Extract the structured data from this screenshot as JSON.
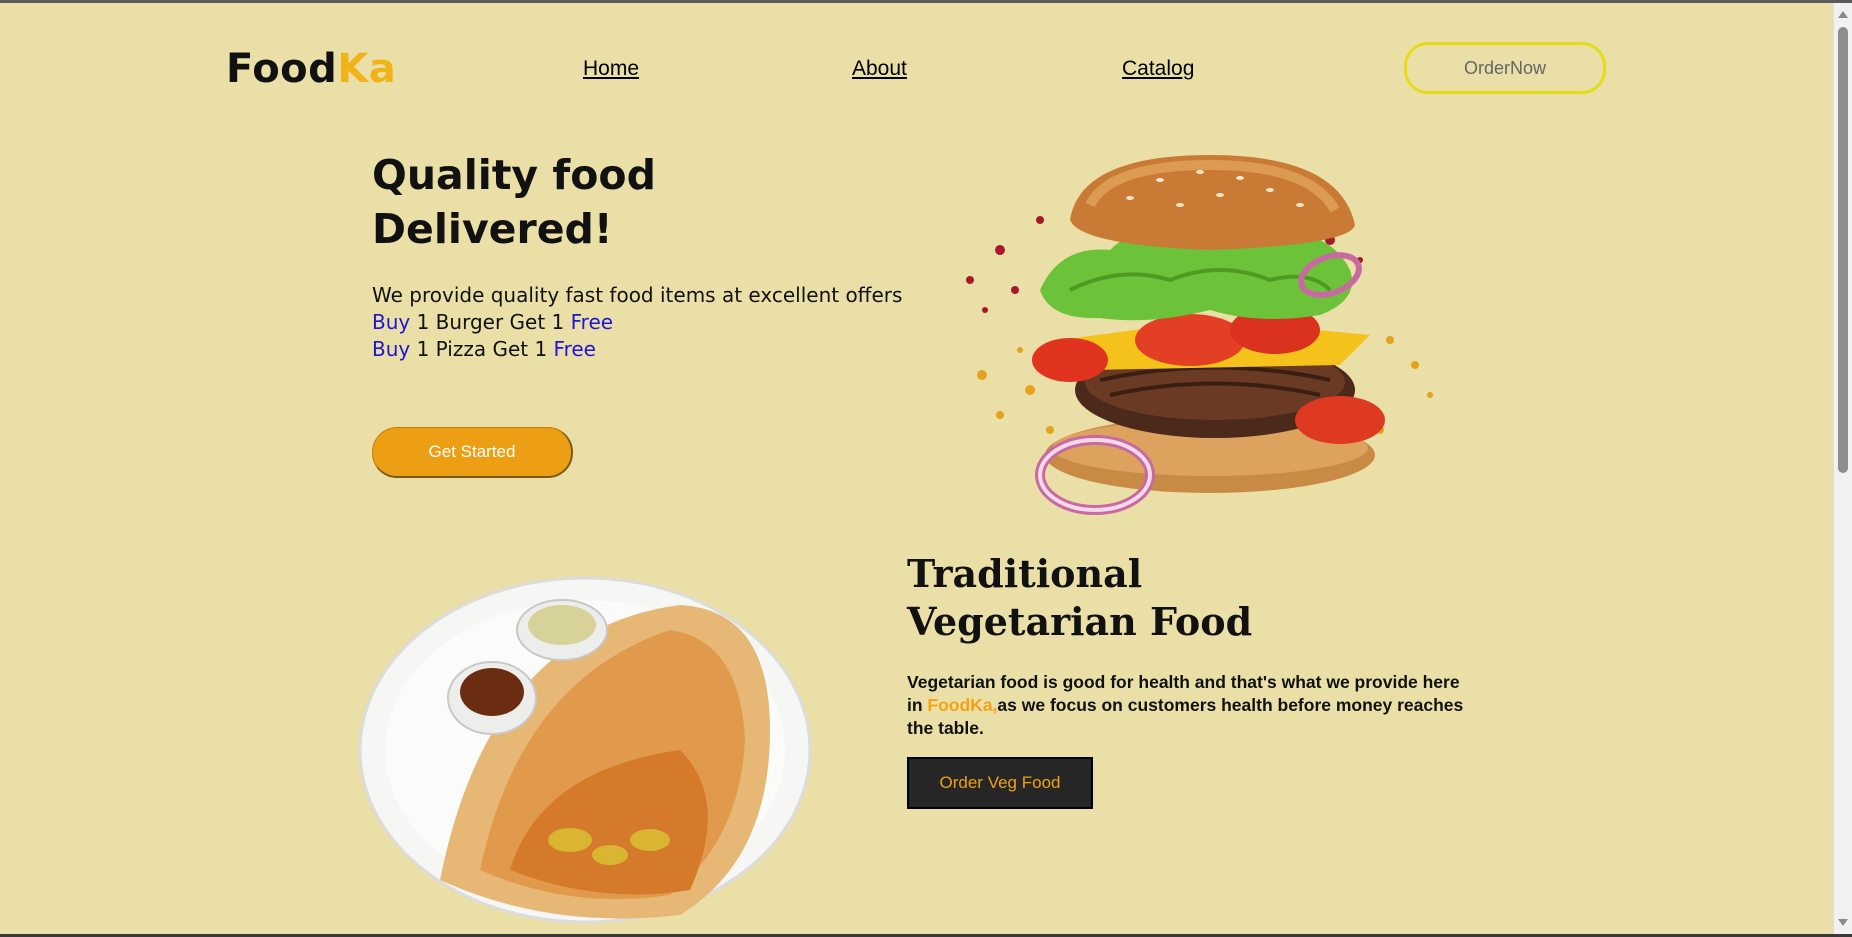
{
  "brand": {
    "name_main": "Food",
    "name_accent": "Ka"
  },
  "nav": {
    "home": "Home",
    "about": "About",
    "catalog": "Catalog",
    "order_now": "OrderNow"
  },
  "hero": {
    "title_line1": "Quality food",
    "title_line2": "Delivered!",
    "desc": "We provide quality fast food items at excellent offers",
    "offer1": {
      "buy": "Buy",
      "middle": " 1 Burger Get 1 ",
      "free": "Free"
    },
    "offer2": {
      "buy": "Buy",
      "middle": " 1 Pizza Get 1 ",
      "free": "Free"
    },
    "cta": "Get Started"
  },
  "veg": {
    "title_line1": "Traditional",
    "title_line2": "Vegetarian Food",
    "desc_before": "Vegetarian food is good for health and that's what we provide here in ",
    "desc_brand": "FoodKa,",
    "desc_after": "as we focus on customers health before money reaches the table.",
    "cta": "Order Veg Food"
  },
  "colors": {
    "background": "#ebdfa8",
    "accent": "#f1b318",
    "button": "#ec9f14",
    "link_blue": "#1d16d4",
    "order_border": "#e2dd18"
  },
  "images": {
    "hero": "burger-image",
    "veg": "dosa-image"
  }
}
